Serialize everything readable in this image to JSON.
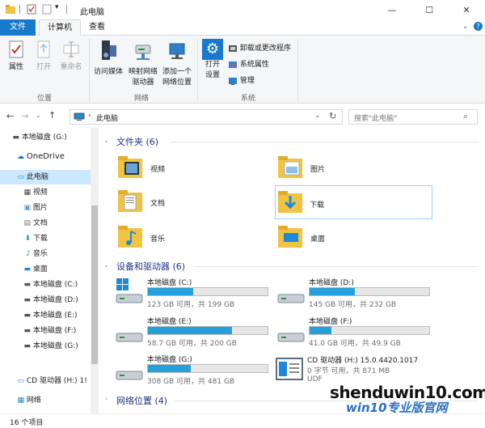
{
  "window": {
    "title": "此电脑",
    "minimize": "—",
    "maximize": "☐",
    "close": "✕"
  },
  "tabs": {
    "file": "文件",
    "computer": "计算机",
    "view": "查看"
  },
  "ribbon": {
    "location": {
      "properties": "属性",
      "open": "打开",
      "rename": "重命名",
      "group": "位置"
    },
    "network": {
      "media": "访问媒体",
      "map_drive_1": "映射网络",
      "map_drive_2": "驱动器",
      "add_loc_1": "添加一个",
      "add_loc_2": "网络位置",
      "group": "网络"
    },
    "system": {
      "open_settings_1": "打开",
      "open_settings_2": "设置",
      "uninstall": "卸载或更改程序",
      "sys_props": "系统属性",
      "manage": "管理",
      "group": "系统"
    }
  },
  "address": {
    "path": "此电脑",
    "search_placeholder": "搜索\"此电脑\""
  },
  "nav": {
    "items": [
      "本地磁盘 (G:)",
      "OneDrive",
      "此电脑",
      "视频",
      "图片",
      "文档",
      "下载",
      "音乐",
      "桌面",
      "本地磁盘 (C:)",
      "本地磁盘 (D:)",
      "本地磁盘 (E:)",
      "本地磁盘 (F:)",
      "本地磁盘 (G:)",
      "CD 驱动器 (H:) 1!",
      "网络"
    ]
  },
  "sections": {
    "folders": "文件夹 (6)",
    "devices": "设备和驱动器 (6)",
    "network": "网络位置 (4)"
  },
  "folders": [
    "视频",
    "图片",
    "文档",
    "下载",
    "音乐",
    "桌面"
  ],
  "drives": [
    {
      "name": "本地磁盘 (C:)",
      "info": "123 GB 可用，共 199 GB",
      "used": 0.38
    },
    {
      "name": "本地磁盘 (D:)",
      "info": "145 GB 可用，共 232 GB",
      "used": 0.375
    },
    {
      "name": "本地磁盘 (E:)",
      "info": "58.7 GB 可用，共 200 GB",
      "used": 0.7
    },
    {
      "name": "本地磁盘 (F:)",
      "info": "41.0 GB 可用，共 49.9 GB",
      "used": 0.18
    },
    {
      "name": "本地磁盘 (G:)",
      "info": "308 GB 可用，共 481 GB",
      "used": 0.36
    }
  ],
  "cd": {
    "name": "CD 驱动器 (H:) 15.0.4420.1017",
    "info": "0 字节 可用，共 871 MB",
    "fs": "UDF"
  },
  "status": {
    "count": "16 个项目"
  },
  "watermark": {
    "text": "shenduwin10.com",
    "sub": "win10专业版官网"
  },
  "colors": {
    "accent": "#1979ca",
    "selection": "#cce8ff",
    "folder": "#f0c443",
    "drive_fill": "#26a0da"
  }
}
